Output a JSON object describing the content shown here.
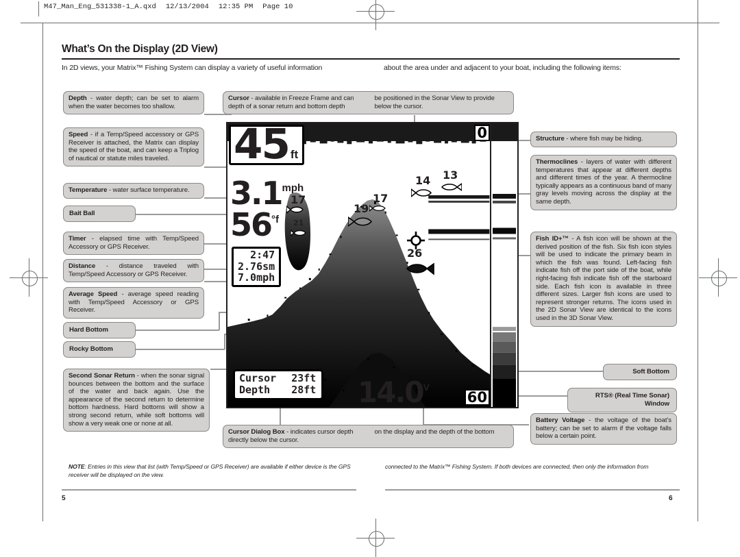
{
  "printer_slug": {
    "filename": "M47_Man_Eng_531338-1_A.qxd",
    "date": "12/13/2004",
    "time": "12:35 PM",
    "page": "Page 10"
  },
  "heading": {
    "title": "What’s On the Display (2D View)",
    "intro_left": "In 2D views, your Matrix™ Fishing System can display a variety of useful information",
    "intro_right": "about the area under and adjacent to your boat, including the following items:"
  },
  "callouts_left": [
    {
      "id": "depth",
      "term": "Depth",
      "text": " - water depth; can be set to alarm when the water becomes too shallow."
    },
    {
      "id": "speed",
      "term": "Speed",
      "text": " - if a Temp/Speed accessory or GPS Receiver is attached, the Matrix can display the speed of the boat, and can keep a Triplog of nautical or statute miles traveled."
    },
    {
      "id": "temperature",
      "term": "Temperature",
      "text": " - water surface temperature."
    },
    {
      "id": "bait-ball",
      "term": "Bait Ball",
      "text": ""
    },
    {
      "id": "timer",
      "term": "Timer",
      "text": " - elapsed time with Temp/Speed Accessory or GPS Receiver."
    },
    {
      "id": "distance",
      "term": "Distance",
      "text": " - distance traveled with Temp/Speed Accessory or GPS Receiver."
    },
    {
      "id": "average-speed",
      "term": "Average Speed",
      "text": " - average speed reading with Temp/Speed Accessory or GPS Receiver."
    },
    {
      "id": "hard-bottom",
      "term": "Hard Bottom",
      "text": ""
    },
    {
      "id": "rocky-bottom",
      "term": "Rocky Bottom",
      "text": ""
    },
    {
      "id": "second-sonar-return",
      "term": "Second Sonar Return",
      "text": " - when the sonar signal bounces between the bottom and the surface of the water and back again. Use the appearance of the second return to determine bottom hardness. Hard bottoms will show a strong second return, while soft bottoms will show a very weak one or none at all."
    }
  ],
  "callouts_center": [
    {
      "id": "cursor",
      "term": "Cursor",
      "text_col1": " - available in Freeze Frame and can depth of a sonar return and bottom depth",
      "text_col2": "be positioned in the Sonar View to provide below the cursor."
    },
    {
      "id": "cursor-dialog-box",
      "term": "Cursor Dialog Box",
      "text_col1": " - indicates cursor depth directly below the cursor.",
      "text_col2": "on  the display and the depth of the bottom"
    }
  ],
  "callouts_right": [
    {
      "id": "structure",
      "term": "Structure",
      "text": " - where fish may be hiding."
    },
    {
      "id": "thermoclines",
      "term": "Thermoclines",
      "text": " - layers of water with different temperatures that appear at different depths and different times of the year.  A thermocline typically appears as a continuous band of many gray levels moving across the display at the same depth."
    },
    {
      "id": "fish-id",
      "term": "Fish ID+™",
      "text": " - A fish icon will be shown at the derived position of the fish. Six fish icon styles will be used to indicate the primary beam in which the fish was found. Left-facing fish indicate fish off the port side of the boat, while right-facing fish indicate fish off the starboard side. Each fish icon is available in three different sizes. Larger fish icons are used to represent stronger returns. The icons used in the 2D Sonar View are identical to the icons used in the 3D Sonar View."
    },
    {
      "id": "soft-bottom",
      "term": "Soft Bottom",
      "text": ""
    },
    {
      "id": "rts-window",
      "term": "RTS® (Real Time Sonar) Window",
      "text": ""
    },
    {
      "id": "battery-voltage",
      "term": "Battery Voltage",
      "text": " - the voltage of the boat’s battery; can be set to alarm if the voltage falls below a certain point."
    }
  ],
  "sonar_display": {
    "depth_value": "45",
    "depth_unit": "ft",
    "speed_value": "3.1",
    "speed_unit": "mph",
    "temp_value": "56",
    "temp_unit": "°f",
    "triplog": {
      "timer": "2:47",
      "distance": "2.76sm",
      "average_speed": "7.0mph"
    },
    "cursor_dialog": {
      "cursor_label": "Cursor",
      "cursor_value": "23ft",
      "depth_label": "Depth",
      "depth_value": "28ft"
    },
    "battery": {
      "value": "14.0",
      "unit": "V"
    },
    "scale_top": "0",
    "scale_bottom": "60",
    "fish_labels": [
      {
        "id": "fish-17-left",
        "label": "17"
      },
      {
        "id": "fish-21-baitball",
        "label": "21"
      },
      {
        "id": "fish-17-center",
        "label": "17"
      },
      {
        "id": "fish-14",
        "label": "14"
      },
      {
        "id": "fish-13",
        "label": "13"
      },
      {
        "id": "fish-19",
        "label": "19"
      },
      {
        "id": "fish-26",
        "label": "26"
      }
    ]
  },
  "note": {
    "label": "NOTE",
    "text_left": ": Entries in this view that list (with Temp/Speed or GPS Receiver) are available if either device is the GPS receiver will be displayed on the view.",
    "text_right": "connected to the Matrix™ Fishing System.  If both devices are connected, then only the information from"
  },
  "footer": {
    "page_left": "5",
    "page_right": "6"
  }
}
